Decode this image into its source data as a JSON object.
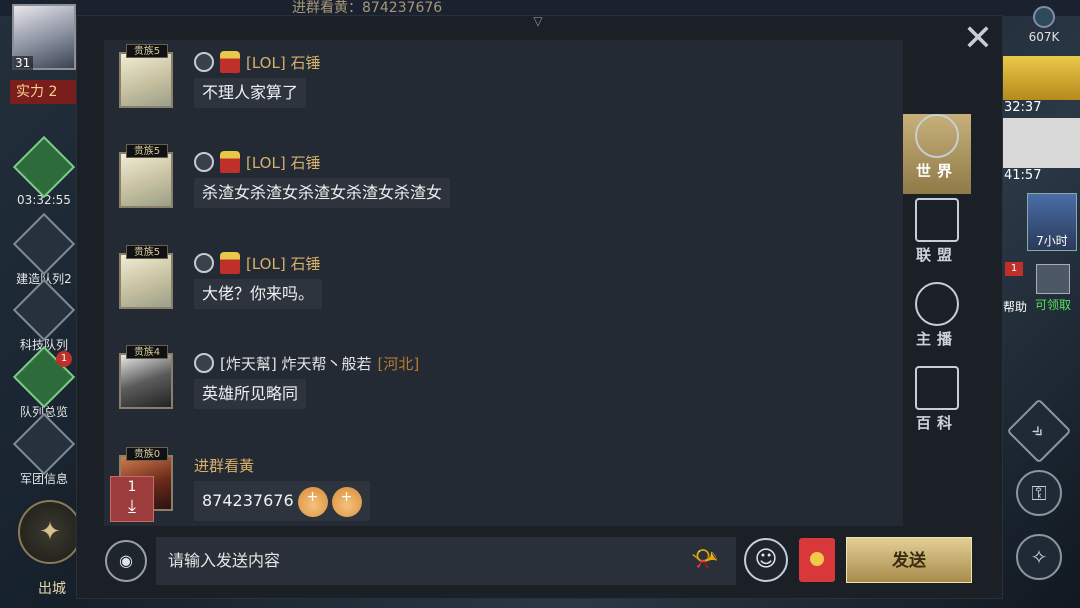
{
  "hud": {
    "player_level": "31",
    "power_label": "实力 2",
    "topbar_text": "进群看黄：874237676",
    "resource_value": "607K",
    "timer_a": "32:37",
    "timer_b": "41:57",
    "castle_label": "7小时",
    "help_label": "帮助",
    "help_badge": "1",
    "claim_label": "可领取",
    "side_buttons": [
      {
        "label": "03:32:55"
      },
      {
        "label": "建造队列2"
      },
      {
        "label": "科技队列"
      },
      {
        "label": "队列总览",
        "badge": "1"
      },
      {
        "label": "军团信息"
      }
    ],
    "out_city_label": "出城"
  },
  "chat": {
    "messages": [
      {
        "vip": "贵族5",
        "name": "[LOL] 石锤",
        "text": "不理人家算了"
      },
      {
        "vip": "贵族5",
        "name": "[LOL] 石锤",
        "text": "杀渣女杀渣女杀渣女杀渣女杀渣女"
      },
      {
        "vip": "贵族5",
        "name": "[LOL] 石锤",
        "text": "大佬？你来吗。"
      },
      {
        "vip": "贵族4",
        "name": "[炸天幫] 炸天帮丶般若",
        "region": "[河北]",
        "text": "英雄所见略同"
      },
      {
        "vip": "贵族0",
        "name": "进群看黃",
        "text": "874237676"
      }
    ],
    "new_count": "1"
  },
  "tabs": [
    {
      "label": "世界",
      "active": true
    },
    {
      "label": "联盟",
      "active": false
    },
    {
      "label": "主播",
      "active": false
    },
    {
      "label": "百科",
      "active": false
    }
  ],
  "input": {
    "placeholder": "请输入发送内容"
  },
  "send_label": "发送",
  "colors": {
    "gold": "#d6b16a",
    "panel": "#1b1f26",
    "chat_bg": "#232a33",
    "send": "#c9b07a"
  }
}
